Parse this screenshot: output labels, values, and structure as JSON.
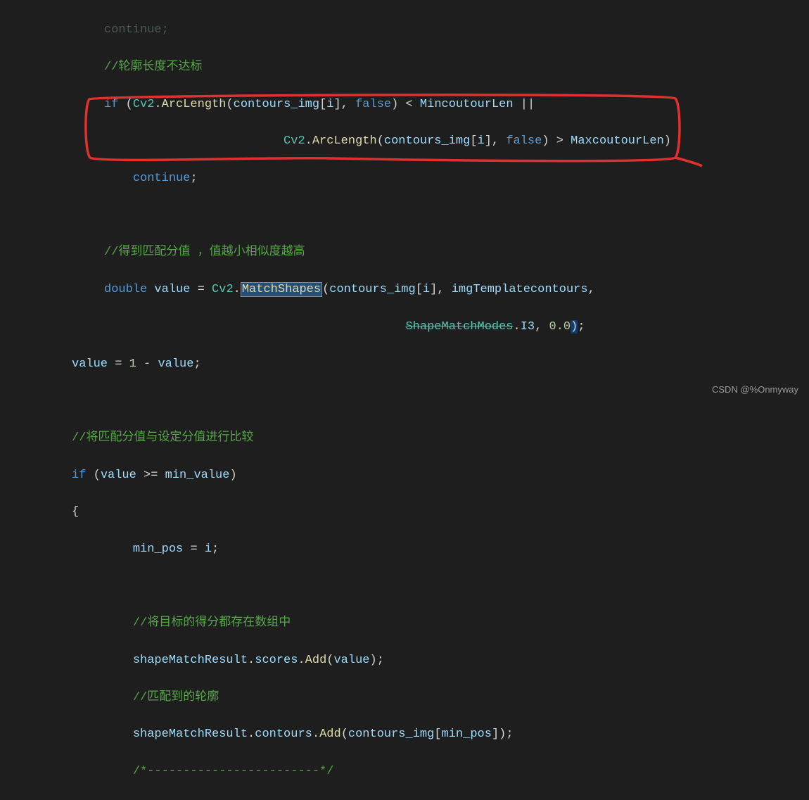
{
  "watermark": "CSDN @%Onmyway",
  "code": {
    "line01_comment": "//轮廓长度不达标",
    "line02": {
      "kw": "if",
      "p1": " (",
      "t1": "Cv2",
      "d1": ".",
      "m1": "ArcLength",
      "p2": "(",
      "v1": "contours_img",
      "b1": "[",
      "i1": "i",
      "b2": "], ",
      "k2": "false",
      "p3": ") < ",
      "v2": "MincoutourLen",
      "op": " ||"
    },
    "line03": {
      "pad": "                         ",
      "t1": "Cv2",
      "d1": ".",
      "m1": "ArcLength",
      "p2": "(",
      "v1": "contours_img",
      "b1": "[",
      "i1": "i",
      "b2": "], ",
      "k2": "false",
      "p3": ") > ",
      "v2": "MaxcoutourLen",
      "p4": ")"
    },
    "line04": {
      "kw": "continue",
      "semi": ";"
    },
    "line06_comment": "//得到匹配分值 ，值越小相似度越高",
    "line07": {
      "kw": "double",
      "v1": " value ",
      "eq": "=",
      "sp": " ",
      "t1": "Cv2",
      "d1": ".",
      "m1": "MatchShapes",
      "p1": "(",
      "a1": "contours_img",
      "b1": "[",
      "i1": "i",
      "b2": "], ",
      "a2": "imgTemplatecontours",
      "c1": ","
    },
    "line08": {
      "pad": "                                          ",
      "t1": "ShapeMatchModes",
      "d1": ".",
      "m1": "I3",
      "c1": ", ",
      "n1": "0.0",
      "p1": ")",
      "semi": ";"
    },
    "line09": {
      "v1": "value ",
      "eq": "=",
      "sp": " ",
      "n1": "1",
      "op": " - ",
      "v2": "value",
      "semi": ";"
    },
    "line11_comment": "//将匹配分值与设定分值进行比较",
    "line12": {
      "kw": "if",
      "p1": " (",
      "v1": "value ",
      "op": ">=",
      "sp": " ",
      "v2": "min_value",
      "p2": ")"
    },
    "line13": "{",
    "line14": {
      "v1": "min_pos ",
      "eq": "=",
      "sp": " ",
      "v2": "i",
      "semi": ";"
    },
    "line16_comment": "//将目标的得分都存在数组中",
    "line17": {
      "v1": "shapeMatchResult",
      "d1": ".",
      "v2": "scores",
      "d2": ".",
      "m1": "Add",
      "p1": "(",
      "a1": "value",
      "p2": ")",
      "semi": ";"
    },
    "line18_comment": "//匹配到的轮廓",
    "line19": {
      "v1": "shapeMatchResult",
      "d1": ".",
      "v2": "contours",
      "d2": ".",
      "m1": "Add",
      "p1": "(",
      "a1": "contours_img",
      "b1": "[",
      "i1": "min_pos",
      "b2": "]",
      "p2": ")",
      "semi": ";"
    },
    "line20": "/*------------------------*/"
  }
}
